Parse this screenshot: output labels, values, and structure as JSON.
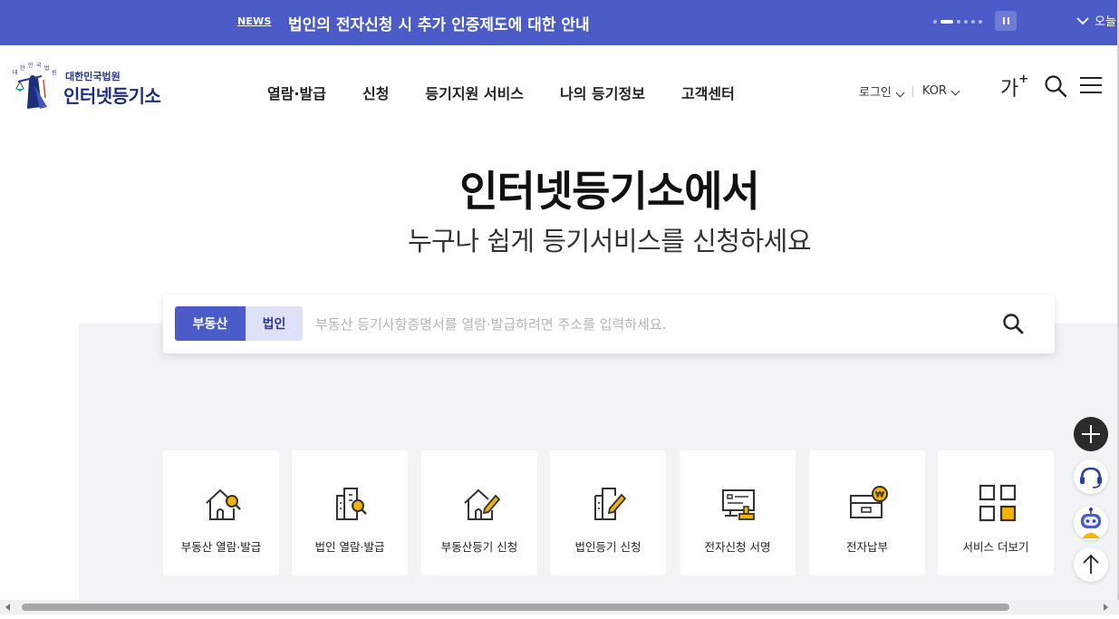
{
  "news": {
    "tag": "NEWS",
    "headline": "법인의 전자신청 시 추가 인증제도에 대한 안내",
    "today_label": "오늘"
  },
  "header": {
    "logo_sub": "대한민국법원",
    "logo_main": "인터넷등기소",
    "nav": [
      "열람·발급",
      "신청",
      "등기지원 서비스",
      "나의 등기정보",
      "고객센터"
    ],
    "login_label": "로그인",
    "language_label": "KOR",
    "font_size_label": "가",
    "font_size_plus": "+"
  },
  "hero": {
    "title": "인터넷등기소에서",
    "subtitle": "누구나 쉽게 등기서비스를 신청하세요"
  },
  "search": {
    "tab_active": "부동산",
    "tab_inactive": "법인",
    "placeholder": "부동산 등기사항증명서를 열람·발급하려면 주소를 입력하세요."
  },
  "services": [
    {
      "label": "부동산 열람·발급",
      "icon": "house-search-icon"
    },
    {
      "label": "법인 열람·발급",
      "icon": "building-search-icon"
    },
    {
      "label": "부동산등기 신청",
      "icon": "house-pen-icon"
    },
    {
      "label": "법인등기 신청",
      "icon": "building-pen-icon"
    },
    {
      "label": "전자신청 서명",
      "icon": "monitor-stamp-icon"
    },
    {
      "label": "전자납부",
      "icon": "wallet-won-icon"
    },
    {
      "label": "서비스 더보기",
      "icon": "grid-icon"
    }
  ],
  "colors": {
    "brand_blue": "#4b5cc9",
    "accent_yellow": "#f5b400",
    "panel_grey": "#f2f3f5"
  }
}
